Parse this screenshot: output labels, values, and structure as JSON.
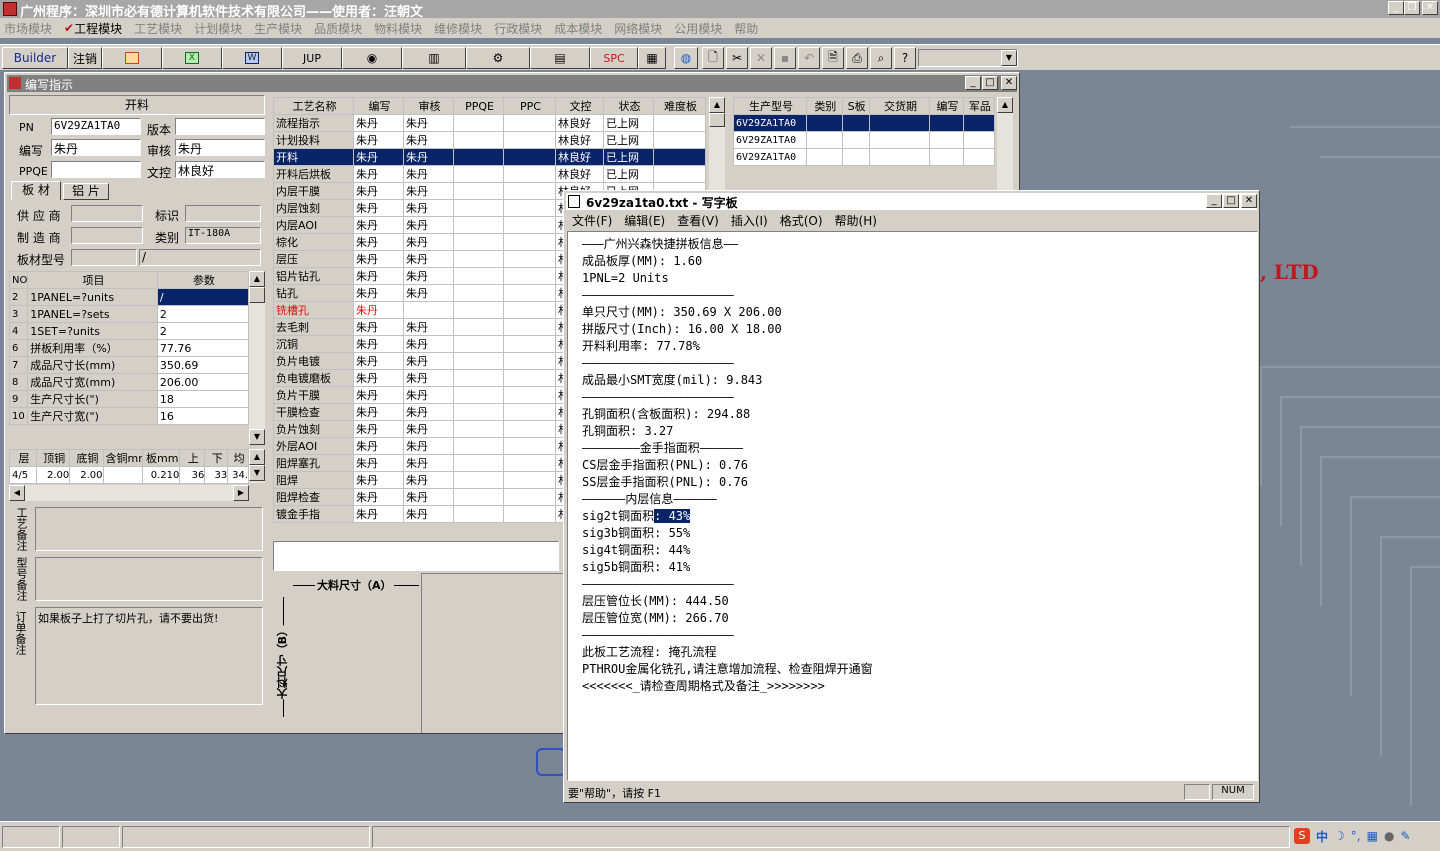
{
  "app": {
    "title": "广州程序：深圳市必有德计算机软件技术有限公司——使用者：汪朝文",
    "menu": [
      "市场模块",
      "工程模块",
      "工艺模块",
      "计划模块",
      "生产模块",
      "品质模块",
      "物料模块",
      "维修模块",
      "行政模块",
      "成本模块",
      "网络模块",
      "公用模块",
      "帮助"
    ],
    "toolbar": {
      "builder": "Builder",
      "logout": "注销",
      "jup": "JUP",
      "spc": "SPC"
    },
    "bg_text": ", LTD"
  },
  "editor": {
    "title": "编写指示",
    "process": "开料",
    "pn_label": "PN",
    "pn": "6V29ZA1TA0",
    "version_label": "版本",
    "author_label": "编写",
    "author": "朱丹",
    "reviewer_label": "审核",
    "reviewer": "朱丹",
    "ppqe_label": "PPQE",
    "doc_label": "文控",
    "doc": "林良好",
    "tabs": [
      "板 材",
      "铝 片"
    ],
    "supplier_label": "供 应 商",
    "mark_label": "标识",
    "maker_label": "制 造 商",
    "class_label": "类别",
    "class": "IT-180A",
    "model_label": "板材型号",
    "model": "/",
    "params_hdr": [
      "NO",
      "项目",
      "参数"
    ],
    "params": [
      [
        "2",
        "1PANEL=?units",
        "/"
      ],
      [
        "3",
        "1PANEL=?sets",
        "2"
      ],
      [
        "4",
        "1SET=?units",
        "2"
      ],
      [
        "6",
        "拼板利用率（%）",
        "77.76"
      ],
      [
        "7",
        "成品尺寸长(mm)",
        "350.69"
      ],
      [
        "8",
        "成品尺寸宽(mm)",
        "206.00"
      ],
      [
        "9",
        "生产尺寸长(\")",
        "18"
      ],
      [
        "10",
        "生产尺寸宽(\")",
        "16"
      ]
    ],
    "layer_hdr": [
      "层",
      "顶铜",
      "底铜",
      "含铜mm",
      "板mm",
      "上",
      "下",
      "均"
    ],
    "layer_row": [
      "4/5",
      "2.00",
      "2.00",
      "",
      "0.210",
      "36",
      "33",
      "34."
    ],
    "notes": [
      {
        "label": "工艺备注",
        "text": ""
      },
      {
        "label": "型号备注",
        "text": ""
      },
      {
        "label": "订单备注",
        "text": "如果板子上打了切片孔，请不要出货!"
      }
    ],
    "proc_hdr": [
      "工艺名称",
      "编写",
      "审核",
      "PPQE",
      "PPC",
      "文控",
      "状态",
      "难度板"
    ],
    "procs": [
      [
        "流程指示",
        "朱丹",
        "朱丹",
        "",
        "",
        "林良好",
        "已上网"
      ],
      [
        "计划投料",
        "朱丹",
        "朱丹",
        "",
        "",
        "林良好",
        "已上网"
      ],
      [
        "开料",
        "朱丹",
        "朱丹",
        "",
        "",
        "林良好",
        "已上网"
      ],
      [
        "开料后烘板",
        "朱丹",
        "朱丹",
        "",
        "",
        "林良好",
        "已上网"
      ],
      [
        "内层干膜",
        "朱丹",
        "朱丹",
        "",
        "",
        "林良好",
        "已上网"
      ],
      [
        "内层蚀刻",
        "朱丹",
        "朱丹",
        "",
        "",
        "林",
        ""
      ],
      [
        "内层AOI",
        "朱丹",
        "朱丹",
        "",
        "",
        "林",
        ""
      ],
      [
        "棕化",
        "朱丹",
        "朱丹",
        "",
        "",
        "林",
        ""
      ],
      [
        "层压",
        "朱丹",
        "朱丹",
        "",
        "",
        "林",
        ""
      ],
      [
        "铝片钻孔",
        "朱丹",
        "朱丹",
        "",
        "",
        "林",
        ""
      ],
      [
        "钻孔",
        "朱丹",
        "朱丹",
        "",
        "",
        "林",
        ""
      ],
      [
        "铣槽孔",
        "朱丹",
        "",
        "",
        "",
        "林",
        ""
      ],
      [
        "去毛刺",
        "朱丹",
        "朱丹",
        "",
        "",
        "林",
        ""
      ],
      [
        "沉铜",
        "朱丹",
        "朱丹",
        "",
        "",
        "林",
        ""
      ],
      [
        "负片电镀",
        "朱丹",
        "朱丹",
        "",
        "",
        "林",
        ""
      ],
      [
        "负电镀磨板",
        "朱丹",
        "朱丹",
        "",
        "",
        "林",
        ""
      ],
      [
        "负片干膜",
        "朱丹",
        "朱丹",
        "",
        "",
        "林",
        ""
      ],
      [
        "干膜检查",
        "朱丹",
        "朱丹",
        "",
        "",
        "林",
        ""
      ],
      [
        "负片蚀刻",
        "朱丹",
        "朱丹",
        "",
        "",
        "林",
        ""
      ],
      [
        "外层AOI",
        "朱丹",
        "朱丹",
        "",
        "",
        "林",
        ""
      ],
      [
        "阻焊塞孔",
        "朱丹",
        "朱丹",
        "",
        "",
        "林",
        ""
      ],
      [
        "阻焊",
        "朱丹",
        "朱丹",
        "",
        "",
        "林",
        ""
      ],
      [
        "阻焊检查",
        "朱丹",
        "朱丹",
        "",
        "",
        "林",
        ""
      ],
      [
        "镀金手指",
        "朱丹",
        "朱丹",
        "",
        "",
        "林",
        ""
      ]
    ],
    "prod_hdr": [
      "生产型号",
      "类别",
      "S板",
      "交货期",
      "编写",
      "军品"
    ],
    "prods": [
      "6V29ZA1TA0",
      "6V29ZA1TA0",
      "6V29ZA1TA0"
    ],
    "dim_a": "大料尺寸（A）",
    "dim_b": "大料尺寸（B）"
  },
  "wordpad": {
    "title": "6v29za1ta0.txt - 写字板",
    "menu": [
      "文件(F)",
      "编辑(E)",
      "查看(V)",
      "插入(I)",
      "格式(O)",
      "帮助(H)"
    ],
    "lines": [
      "———广州兴森快捷拼板信息——",
      "成品板厚(MM): 1.60",
      "1PNL=2 Units",
      "—————————————————————",
      "单只尺寸(MM): 350.69 X 206.00",
      "拼版尺寸(Inch): 16.00 X 18.00",
      "开料利用率: 77.78%",
      "—————————————————————",
      "成品最小SMT宽度(mil): 9.843",
      "—————————————————————",
      "孔铜面积(含板面积): 294.88",
      "孔铜面积: 3.27",
      "————————金手指面积——————",
      "CS层金手指面积(PNL): 0.76",
      "SS层金手指面积(PNL): 0.76",
      "——————内层信息——————",
      "sig2t铜面积: 43%",
      "sig3b铜面积: 55%",
      "sig4t铜面积: 44%",
      "sig5b铜面积: 41%",
      "—————————————————————",
      "层压管位长(MM): 444.50",
      "层压管位宽(MM): 266.70",
      "—————————————————————",
      "此板工艺流程: 掩孔流程",
      "PTHROU金属化铣孔,请注意增加流程、检查阻焊开通窗",
      "<<<<<<<_请检查周期格式及备注_>>>>>>>>"
    ],
    "status": "要\"帮助\"，请按 F1",
    "num": "NUM"
  },
  "tray": {
    "ime": "中"
  }
}
